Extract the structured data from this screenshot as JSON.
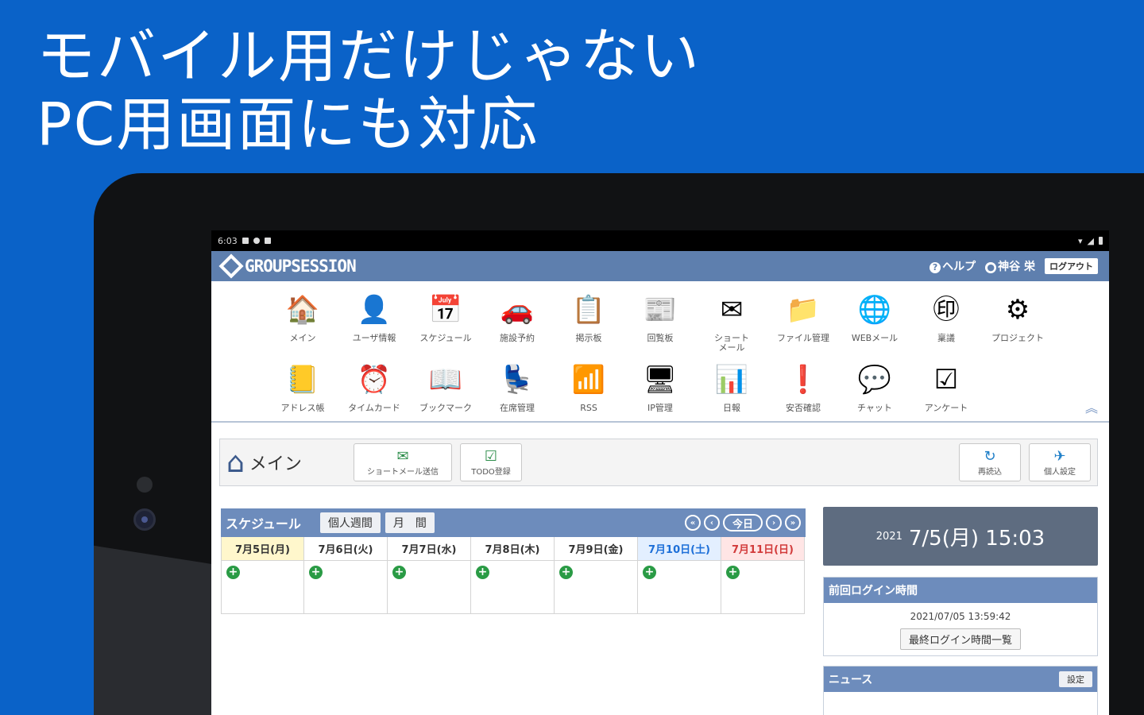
{
  "headline": {
    "line1": "モバイル用だけじゃない",
    "line2": "PC用画面にも対応"
  },
  "statusbar": {
    "time": "6:03"
  },
  "app": {
    "logo_text": "GROUPSESSION",
    "help_label": "ヘルプ",
    "user_name": "神谷 栄",
    "logout_label": "ログアウト"
  },
  "menu": {
    "row1": [
      {
        "label": "メイン",
        "icon": "🏠"
      },
      {
        "label": "ユーザ情報",
        "icon": "👤"
      },
      {
        "label": "スケジュール",
        "icon": "📅"
      },
      {
        "label": "施設予約",
        "icon": "🚗"
      },
      {
        "label": "掲示板",
        "icon": "📋"
      },
      {
        "label": "回覧板",
        "icon": "📰"
      },
      {
        "label": "ショート\nメール",
        "icon": "✉"
      },
      {
        "label": "ファイル管理",
        "icon": "📁"
      },
      {
        "label": "WEBメール",
        "icon": "🌐"
      },
      {
        "label": "稟議",
        "icon": "㊞"
      },
      {
        "label": "プロジェクト",
        "icon": "⚙"
      }
    ],
    "row2": [
      {
        "label": "アドレス帳",
        "icon": "📒"
      },
      {
        "label": "タイムカード",
        "icon": "⏰"
      },
      {
        "label": "ブックマーク",
        "icon": "📖"
      },
      {
        "label": "在席管理",
        "icon": "💺"
      },
      {
        "label": "RSS",
        "icon": "📶"
      },
      {
        "label": "IP管理",
        "icon": "🖥"
      },
      {
        "label": "日報",
        "icon": "📊"
      },
      {
        "label": "安否確認",
        "icon": "❗"
      },
      {
        "label": "チャット",
        "icon": "💬"
      },
      {
        "label": "アンケート",
        "icon": "☑"
      }
    ]
  },
  "toolbar": {
    "home_label": "メイン",
    "shortmail_btn": "ショートメール送信",
    "todo_btn": "TODO登録",
    "reload_btn": "再読込",
    "personal_btn": "個人設定"
  },
  "schedule": {
    "title": "スケジュール",
    "tab_week": "個人週間",
    "tab_month": "月　間",
    "today_label": "今日",
    "days": [
      {
        "label": "7月5日(月)",
        "type": "today"
      },
      {
        "label": "7月6日(火)",
        "type": "weekday"
      },
      {
        "label": "7月7日(水)",
        "type": "weekday"
      },
      {
        "label": "7月8日(木)",
        "type": "weekday"
      },
      {
        "label": "7月9日(金)",
        "type": "weekday"
      },
      {
        "label": "7月10日(土)",
        "type": "sat"
      },
      {
        "label": "7月11日(日)",
        "type": "sun"
      }
    ]
  },
  "clock": {
    "year": "2021",
    "datetime": "7/5(月) 15:03"
  },
  "login_panel": {
    "title": "前回ログイン時間",
    "timestamp": "2021/07/05 13:59:42",
    "list_btn": "最終ログイン時間一覧"
  },
  "news_panel": {
    "title": "ニュース",
    "settings_btn": "設定"
  }
}
